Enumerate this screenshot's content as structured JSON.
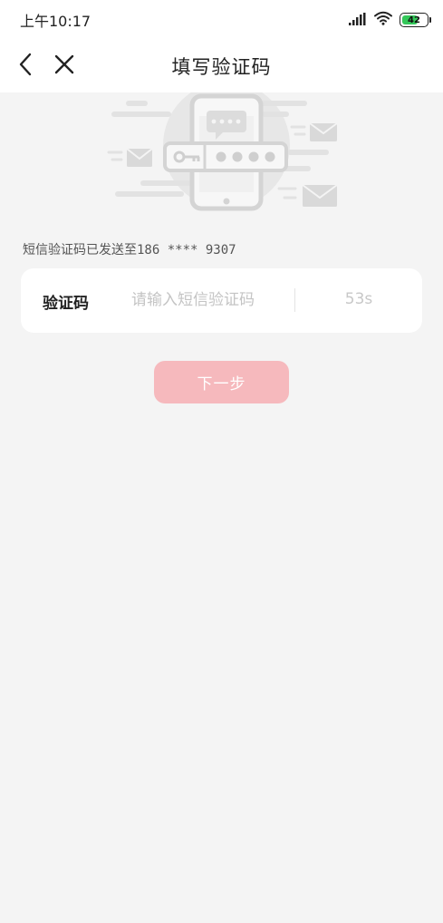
{
  "status_bar": {
    "time": "上午10:17",
    "battery_level": "42",
    "icons": [
      "signal-icon",
      "wifi-icon",
      "battery-icon"
    ]
  },
  "nav": {
    "title": "填写验证码",
    "back_icon": "chevron-left-icon",
    "close_icon": "close-icon"
  },
  "hero": {
    "illustration": "phone-verification-code-illustration"
  },
  "sent_notice": {
    "label": "短信验证码已发送至",
    "phone": "186 **** 9307"
  },
  "code_field": {
    "label": "验证码",
    "placeholder": "请输入短信验证码",
    "value": "",
    "countdown": "53s"
  },
  "next_button": {
    "label": "下一步",
    "enabled": false
  },
  "colors": {
    "background": "#f4f4f4",
    "button_disabled": "#f6b9bd",
    "placeholder": "#c4c4c4",
    "battery_fill": "#34c759"
  }
}
